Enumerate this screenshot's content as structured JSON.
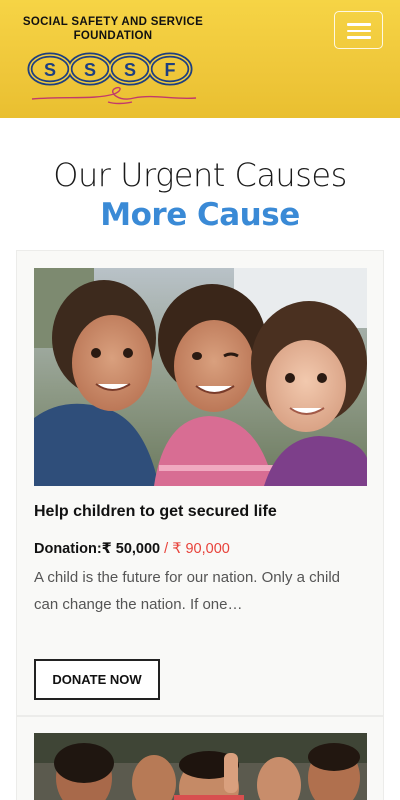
{
  "header": {
    "logo_line1": "SOCIAL SAFETY AND SERVICE",
    "logo_line2": "FOUNDATION",
    "logo_letters": [
      "S",
      "S",
      "S",
      "F"
    ],
    "menu_icon": "hamburger-menu-icon",
    "colors": {
      "background": "#f2cc3e",
      "logo_ring": "#1e3f80",
      "logo_swash": "#c23a6b"
    }
  },
  "section": {
    "title": "Our Urgent Causes",
    "subtitle": "More Cause",
    "subtitle_color": "#3a8ad6"
  },
  "causes": [
    {
      "title": "Help children to get secured life",
      "donation_label": "Donation:₹ 50,000",
      "goal": "/ ₹ 90,000",
      "description": "A child is the future for our nation. Only a child can change the nation. If one…",
      "button_label": "DONATE NOW",
      "image": "three-smiling-children-photo"
    },
    {
      "image": "group-of-children-photo"
    }
  ],
  "colors": {
    "goal_text": "#e8423a"
  }
}
